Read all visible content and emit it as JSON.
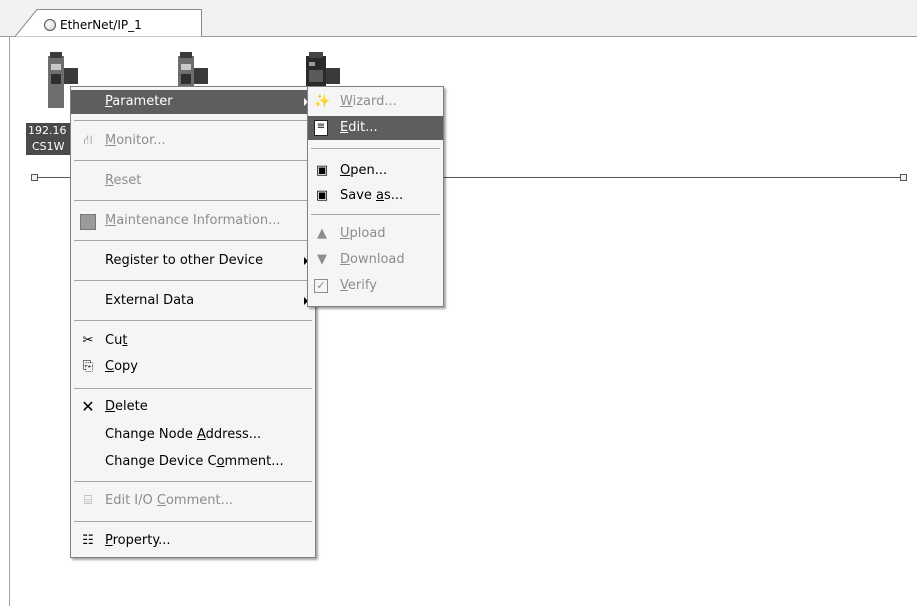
{
  "tab": {
    "label": "EtherNet/IP_1"
  },
  "devices": [
    {
      "label_line1": "192.16",
      "label_line2": "CS1W"
    }
  ],
  "context_menu": {
    "items": [
      {
        "text": "Parameter",
        "u": "P"
      },
      {
        "text": "Monitor...",
        "u": "M"
      },
      {
        "text": "Reset",
        "u": "R"
      },
      {
        "text": "Maintenance Information...",
        "u": "M"
      },
      {
        "text": "Register to other Device"
      },
      {
        "text": "External Data"
      },
      {
        "pre": "Cu",
        "u": "t",
        "post": ""
      },
      {
        "text": "Copy",
        "u": "C"
      },
      {
        "text": "Delete",
        "u": "D"
      },
      {
        "pre": "Change Node ",
        "u": "A",
        "post": "ddress..."
      },
      {
        "pre": "Change Device C",
        "u": "o",
        "post": "mment..."
      },
      {
        "pre": "Edit I/O ",
        "u": "C",
        "post": "omment..."
      },
      {
        "text": "Property...",
        "u": "P"
      }
    ]
  },
  "submenu": {
    "items": [
      {
        "text": "Wizard...",
        "u": "W"
      },
      {
        "text": "Edit...",
        "u": "E"
      },
      {
        "text": "Open...",
        "u": "O"
      },
      {
        "pre": "Save ",
        "u": "a",
        "post": "s..."
      },
      {
        "text": "Upload",
        "u": "U"
      },
      {
        "text": "Download",
        "u": "D"
      },
      {
        "text": "Verify",
        "u": "V"
      }
    ]
  }
}
